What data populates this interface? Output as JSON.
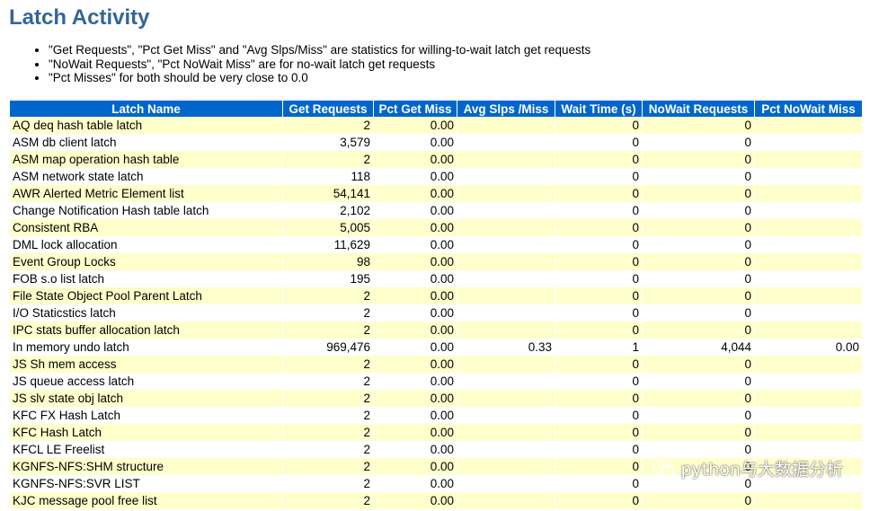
{
  "title": "Latch Activity",
  "notes": [
    "\"Get Requests\", \"Pct Get Miss\" and \"Avg Slps/Miss\" are statistics for willing-to-wait latch get requests",
    "\"NoWait Requests\", \"Pct NoWait Miss\" are for no-wait latch get requests",
    "\"Pct Misses\" for both should be very close to 0.0"
  ],
  "table": {
    "headers": [
      "Latch Name",
      "Get Requests",
      "Pct Get Miss",
      "Avg Slps /Miss",
      "Wait Time (s)",
      "NoWait Requests",
      "Pct NoWait Miss"
    ],
    "rows": [
      [
        "AQ deq hash table latch",
        "2",
        "0.00",
        "",
        "0",
        "0",
        ""
      ],
      [
        "ASM db client latch",
        "3,579",
        "0.00",
        "",
        "0",
        "0",
        ""
      ],
      [
        "ASM map operation hash table",
        "2",
        "0.00",
        "",
        "0",
        "0",
        ""
      ],
      [
        "ASM network state latch",
        "118",
        "0.00",
        "",
        "0",
        "0",
        ""
      ],
      [
        "AWR Alerted Metric Element list",
        "54,141",
        "0.00",
        "",
        "0",
        "0",
        ""
      ],
      [
        "Change Notification Hash table latch",
        "2,102",
        "0.00",
        "",
        "0",
        "0",
        ""
      ],
      [
        "Consistent RBA",
        "5,005",
        "0.00",
        "",
        "0",
        "0",
        ""
      ],
      [
        "DML lock allocation",
        "11,629",
        "0.00",
        "",
        "0",
        "0",
        ""
      ],
      [
        "Event Group Locks",
        "98",
        "0.00",
        "",
        "0",
        "0",
        ""
      ],
      [
        "FOB s.o list latch",
        "195",
        "0.00",
        "",
        "0",
        "0",
        ""
      ],
      [
        "File State Object Pool Parent Latch",
        "2",
        "0.00",
        "",
        "0",
        "0",
        ""
      ],
      [
        "I/O Staticstics latch",
        "2",
        "0.00",
        "",
        "0",
        "0",
        ""
      ],
      [
        "IPC stats buffer allocation latch",
        "2",
        "0.00",
        "",
        "0",
        "0",
        ""
      ],
      [
        "In memory undo latch",
        "969,476",
        "0.00",
        "0.33",
        "1",
        "4,044",
        "0.00"
      ],
      [
        "JS Sh mem access",
        "2",
        "0.00",
        "",
        "0",
        "0",
        ""
      ],
      [
        "JS queue access latch",
        "2",
        "0.00",
        "",
        "0",
        "0",
        ""
      ],
      [
        "JS slv state obj latch",
        "2",
        "0.00",
        "",
        "0",
        "0",
        ""
      ],
      [
        "KFC FX Hash Latch",
        "2",
        "0.00",
        "",
        "0",
        "0",
        ""
      ],
      [
        "KFC Hash Latch",
        "2",
        "0.00",
        "",
        "0",
        "0",
        ""
      ],
      [
        "KFCL LE Freelist",
        "2",
        "0.00",
        "",
        "0",
        "0",
        ""
      ],
      [
        "KGNFS-NFS:SHM structure",
        "2",
        "0.00",
        "",
        "0",
        "0",
        ""
      ],
      [
        "KGNFS-NFS:SVR LIST",
        "2",
        "0.00",
        "",
        "0",
        "0",
        ""
      ],
      [
        "KJC message pool free list",
        "2",
        "0.00",
        "",
        "0",
        "0",
        ""
      ]
    ]
  },
  "watermark": {
    "text": "python与大数据分析",
    "icon": "wechat-icon"
  },
  "colors": {
    "title": "#336699",
    "header_bg": "#0066cc",
    "header_text": "#ffffff",
    "row_odd": "#ffffcc",
    "row_even": "#ffffff"
  }
}
